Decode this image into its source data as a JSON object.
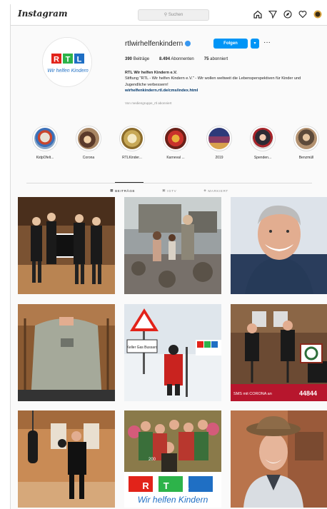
{
  "nav": {
    "logo": "Instagram",
    "search_placeholder": "Suchen",
    "icons": [
      "home-icon",
      "direct-icon",
      "explore-icon",
      "heart-icon",
      "profile-avatar-icon"
    ]
  },
  "profile": {
    "username": "rtlwirhelfenkindern",
    "follow_label": "Folgen",
    "stats": {
      "posts_count": "390",
      "posts_label": "Beiträge",
      "followers_count": "8.494",
      "followers_label": "Abonnenten",
      "following_count": "75",
      "following_label": "abonniert"
    },
    "bio": {
      "name": "RTL Wir helfen Kindern e.V.",
      "text": "Stiftung \"RTL - Wir helfen Kindern e.V.\" - Wir wollen weltweit die Lebensperspektiven für Kinder und Jugendliche verbessern!",
      "link": "wirhelfenkindern.rtl.de/cms/index.html"
    },
    "followed_by": "Von mediengruppe_rtl abonniert",
    "logo_text_rtl": "RTL",
    "logo_text_sub": "Wir helfen Kindern"
  },
  "highlights": [
    {
      "label": "KidpOfelt..."
    },
    {
      "label": "Corona"
    },
    {
      "label": "RTLKinder..."
    },
    {
      "label": "Karneval ..."
    },
    {
      "label": "2019"
    },
    {
      "label": "Spenden..."
    },
    {
      "label": "Benzmüll"
    }
  ],
  "tabs": [
    {
      "label": "BEITRÄGE",
      "active": true
    },
    {
      "label": "IGTV",
      "active": false
    },
    {
      "label": "MARKIERT",
      "active": false
    }
  ],
  "posts": {
    "p6_sms": "SMS mit CORONA an",
    "p6_number": "44844",
    "p8_logo": "RTL",
    "p8_sub": "Wir helfen Kindern",
    "p8_count": "200",
    "p5_sign": "Keller Gas Bussard"
  },
  "colors": {
    "accent": "#0095f6",
    "rtl_red": "#e2231a",
    "rtl_green": "#2db34a",
    "rtl_blue": "#1f6fc4"
  }
}
